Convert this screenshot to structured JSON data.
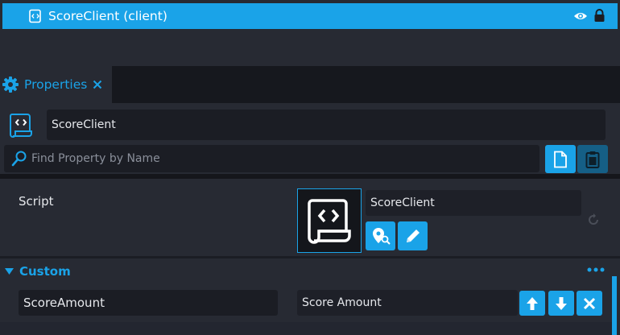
{
  "hierarchy": {
    "selected_item": "ScoreClient (client)"
  },
  "properties_tab": {
    "label": "Properties"
  },
  "object": {
    "name": "ScoreClient"
  },
  "search": {
    "placeholder": "Find Property by Name"
  },
  "script_property": {
    "label": "Script",
    "value": "ScoreClient"
  },
  "custom_section": {
    "label": "Custom",
    "property": {
      "name": "ScoreAmount",
      "value": "Score Amount"
    }
  },
  "colors": {
    "accent": "#1aa3e8",
    "panel": "#272a33",
    "field": "#1b1d24"
  }
}
